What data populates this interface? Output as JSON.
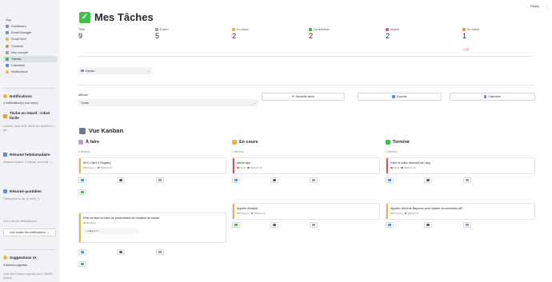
{
  "app": {
    "deploy_label": "Deploy",
    "menu_icon": "kebab-icon"
  },
  "sidebar": {
    "app_label": "App",
    "items": [
      {
        "label": "Dashboard",
        "icon": "home-icon",
        "color": "#7a8fb0",
        "active": false
      },
      {
        "label": "Email Manager",
        "icon": "mail-icon",
        "color": "#7a8fb0",
        "active": false
      },
      {
        "label": "Email Suivi",
        "icon": "mail-track-icon",
        "color": "#e0b84a",
        "active": false
      },
      {
        "label": "Contacts",
        "icon": "contacts-icon",
        "color": "#c78e53",
        "active": false
      },
      {
        "label": "Mon compte",
        "icon": "account-icon",
        "color": "#9aa3ad",
        "active": false
      },
      {
        "label": "Tâches",
        "icon": "tasks-icon",
        "color": "#3fbf4a",
        "active": true
      },
      {
        "label": "Calendrier",
        "icon": "calendar-icon",
        "color": "#5b8bd6",
        "active": false
      },
      {
        "label": "Notifications",
        "icon": "bell-icon",
        "color": "#e0b84a",
        "active": false
      }
    ],
    "notifications": {
      "title": "Notifications",
      "count_text": "1 notification(s) non lue(s)",
      "item1_title": "Tâche en retard : robot facile",
      "item1_text": "La tâche 'robot facile' devait être réalisée le 1 jan...",
      "item2_title": "Résumé hebdomadaire",
      "item2_text": "Semaine écoulée : 3 réalisée, prévue(s) : 1...",
      "item3_title": "Résumé quotidien",
      "item3_text": "Tâches pour ce jour (à venir) : 1 ...",
      "see_all_text": "Voir toutes les notifications ici",
      "see_all_button": "Voir toutes les notifications →"
    },
    "suggestions": {
      "title": "Suggestions IA",
      "subtitle": "3 tâches urgentes",
      "text": "Vous avez 3 tâches urgentes dont 1 bientôt (retard)."
    }
  },
  "header": {
    "title": "Mes Tâches",
    "title_icon": "check-box-icon"
  },
  "metrics": [
    {
      "label": "Total",
      "value": "9",
      "icon": "",
      "color": ""
    },
    {
      "label": "À faire",
      "value": "5",
      "icon": "pin-icon",
      "color": "#9aa3ad"
    },
    {
      "label": "En cours",
      "value": "2",
      "icon": "hourglass-icon",
      "color": "#e0b84a"
    },
    {
      "label": "Complétées",
      "value": "2",
      "icon": "check-box-icon",
      "color": "#3fbf4a"
    },
    {
      "label": "Urgent",
      "value": "2",
      "icon": "red-circle-icon",
      "color": "#e05252"
    },
    {
      "label": "En retard",
      "value": "1",
      "icon": "warning-icon",
      "color": "#e0a030",
      "delta": "↓ -1"
    }
  ],
  "filters": {
    "view_select": "Kanban",
    "filter_label": "Afficher",
    "filter_select": "Toutes",
    "new_task_button": "Nouvelle tâche",
    "export_button": "Exporter",
    "calendar_button": "Calendrier"
  },
  "kanban": {
    "section_title": "Vue Kanban",
    "columns": [
      {
        "title": "À faire",
        "count": "5 tâche(s)",
        "icon": "todo-icon",
        "color": "#c0a0c8"
      },
      {
        "title": "En cours",
        "count": "2 tâche(s)",
        "icon": "hourglass-icon",
        "color": "#e0b84a"
      },
      {
        "title": "Terminé",
        "count": "2 tâche(s)",
        "icon": "check-box-icon",
        "color": "#3fbf4a"
      }
    ],
    "cards": [
      {
        "title": "KEV Client 3 Registry",
        "meta": "Moyenne",
        "date": "2025-01-15",
        "color": "#e0b84a"
      },
      {
        "title": "Rôle de faire la vidéo de présentation de mutation de travail.",
        "meta": "Moyenne",
        "date": "",
        "code": "</email/>",
        "color": "#e0b84a"
      },
      {
        "title": "article app",
        "meta": "Haute",
        "date": "2025-01-14",
        "color": "#e05252"
      },
      {
        "title": "Appeler Adelphe",
        "meta": "Moyenne",
        "date": "2025-01-13",
        "color": "#e0b84a"
      },
      {
        "title": "Faire la vidéo d'accueil de l'app",
        "meta": "Haute",
        "date": "2025-01-12",
        "color": "#e05252"
      },
      {
        "title": "Appeler client de Bayonne pour réparer la connexion API",
        "meta": "Moyenne",
        "date": "2025-01-11",
        "color": "#e0b84a"
      }
    ],
    "actions": {
      "move": "→",
      "edit": "✎",
      "delete": "🗑"
    }
  }
}
